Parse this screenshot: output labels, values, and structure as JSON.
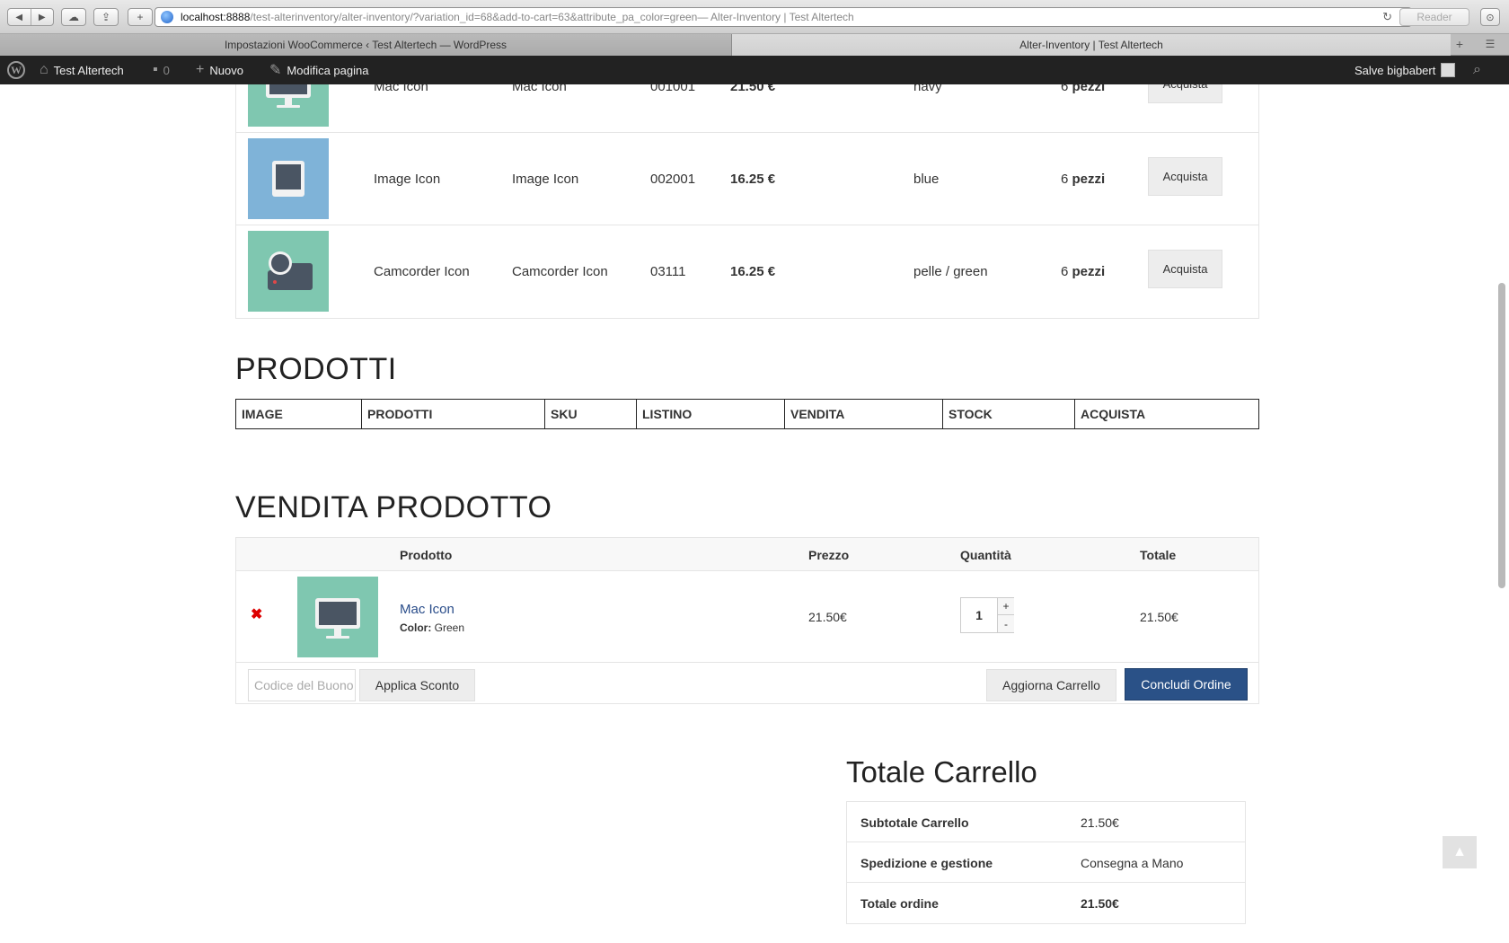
{
  "browser": {
    "url_host": "localhost:8888",
    "url_rest": "/test-alterinventory/alter-inventory/?variation_id=68&add-to-cart=63&attribute_pa_color=green",
    "url_title": " — Alter-Inventory | Test Altertech",
    "reader_label": "Reader",
    "tabs": [
      {
        "label": "Impostazioni WooCommerce ‹ Test Altertech — WordPress"
      },
      {
        "label": "Alter-Inventory | Test Altertech"
      }
    ]
  },
  "adminbar": {
    "site_name": "Test Altertech",
    "comments_count": "0",
    "new_label": "Nuovo",
    "edit_label": "Modifica pagina",
    "greeting": "Salve bigbabert"
  },
  "variations": [
    {
      "image": "monitor",
      "name": "Mac Icon",
      "product": "Mac Icon",
      "sku": "001001",
      "price": "21.50 €",
      "attr": "navy",
      "stock_num": "6",
      "stock_unit": "pezzi",
      "buy_label": "Acquista"
    },
    {
      "image": "image",
      "name": "Image Icon",
      "product": "Image Icon",
      "sku": "002001",
      "price": "16.25 €",
      "attr": "blue",
      "stock_num": "6",
      "stock_unit": "pezzi",
      "buy_label": "Acquista"
    },
    {
      "image": "camcorder",
      "name": "Camcorder Icon",
      "product": "Camcorder Icon",
      "sku": "03111",
      "price": "16.25 €",
      "attr": "pelle / green",
      "stock_num": "6",
      "stock_unit": "pezzi",
      "buy_label": "Acquista"
    }
  ],
  "prodotti": {
    "title": "PRODOTTI",
    "headers": [
      "IMAGE",
      "PRODOTTI",
      "SKU",
      "LISTINO",
      "VENDITA",
      "STOCK",
      "ACQUISTA"
    ]
  },
  "vendita": {
    "title": "VENDITA PRODOTTO",
    "headers": {
      "product": "Prodotto",
      "price": "Prezzo",
      "qty": "Quantità",
      "total": "Totale"
    },
    "item": {
      "remove_symbol": "✖",
      "name": "Mac Icon",
      "attr_label": "Color:",
      "attr_value": "Green",
      "price": "21.50€",
      "qty": "1",
      "total": "21.50€"
    },
    "coupon_placeholder": "Codice del Buono",
    "apply_label": "Applica Sconto",
    "update_label": "Aggiorna Carrello",
    "checkout_label": "Concludi Ordine"
  },
  "totals": {
    "title": "Totale Carrello",
    "rows": [
      {
        "label": "Subtotale Carrello",
        "value": "21.50€"
      },
      {
        "label": "Spedizione e gestione",
        "value": "Consegna a Mano"
      },
      {
        "label": "Totale ordine",
        "value": "21.50€"
      }
    ]
  },
  "colors": {
    "thumb_green": "#7fc7b0",
    "thumb_blue": "#7fb3d8",
    "checkout_blue": "#2a5187",
    "link_blue": "#2a4d8a"
  }
}
